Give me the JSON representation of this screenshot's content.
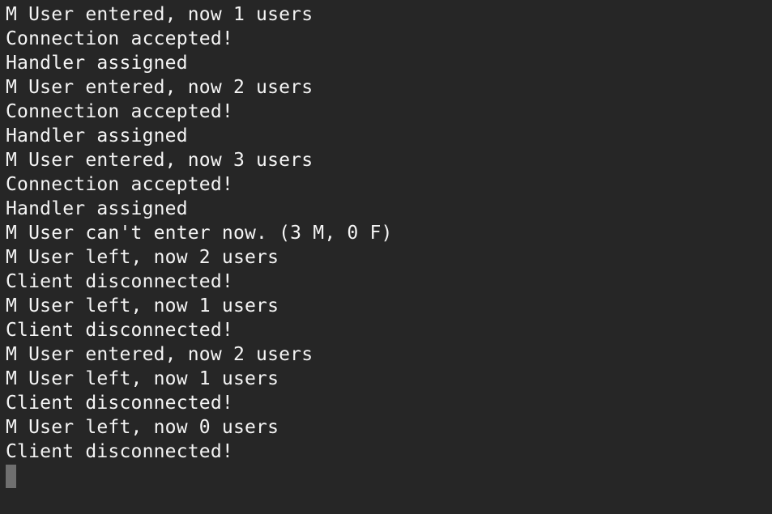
{
  "terminal": {
    "lines": [
      "M User entered, now 1 users",
      "Connection accepted!",
      "Handler assigned",
      "M User entered, now 2 users",
      "Connection accepted!",
      "Handler assigned",
      "M User entered, now 3 users",
      "Connection accepted!",
      "Handler assigned",
      "M User can't enter now. (3 M, 0 F)",
      "M User left, now 2 users",
      "Client disconnected!",
      "M User left, now 1 users",
      "Client disconnected!",
      "M User entered, now 2 users",
      "M User left, now 1 users",
      "Client disconnected!",
      "M User left, now 0 users",
      "Client disconnected!"
    ],
    "colors": {
      "background": "#262626",
      "text": "#f4f4f4",
      "cursor": "#6f6f6f"
    }
  }
}
